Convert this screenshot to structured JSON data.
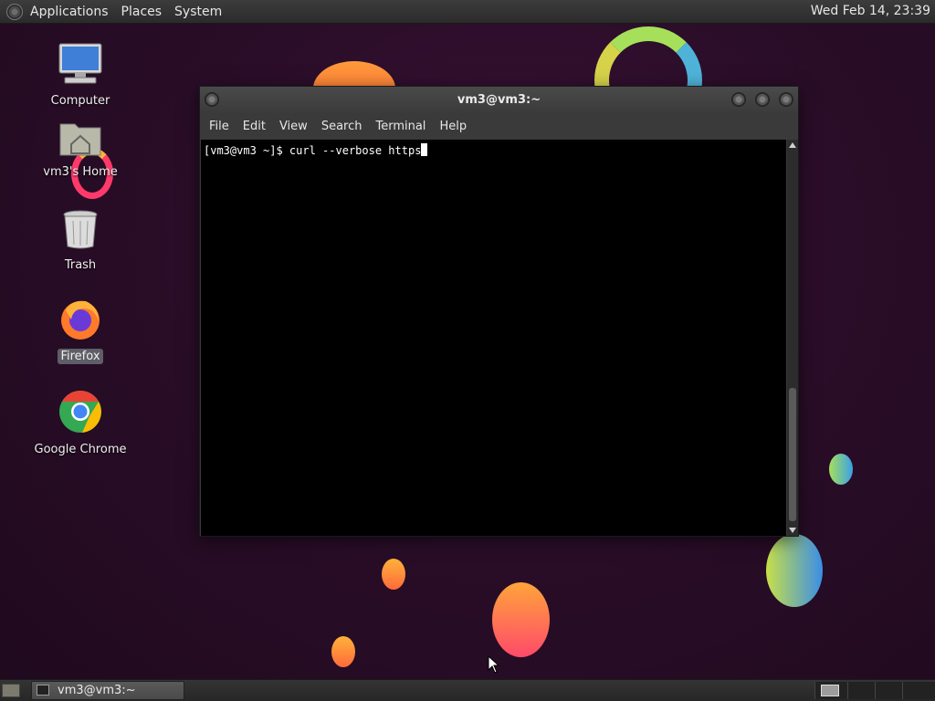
{
  "top_panel": {
    "menus": [
      "Applications",
      "Places",
      "System"
    ],
    "clock": "Wed Feb 14, 23:39"
  },
  "desktop": {
    "icons": [
      {
        "label": "Computer",
        "icon": "computer-icon"
      },
      {
        "label": "vm3's Home",
        "icon": "home-folder-icon"
      },
      {
        "label": "Trash",
        "icon": "trash-icon"
      },
      {
        "label": "Firefox",
        "icon": "firefox-icon",
        "selected": true
      },
      {
        "label": "Google Chrome",
        "icon": "chrome-icon"
      }
    ]
  },
  "terminal": {
    "title": "vm3@vm3:~",
    "menu": [
      "File",
      "Edit",
      "View",
      "Search",
      "Terminal",
      "Help"
    ],
    "prompt": "[vm3@vm3 ~]$ ",
    "command": "curl --verbose https"
  },
  "bottom_panel": {
    "task_label": "vm3@vm3:~"
  }
}
